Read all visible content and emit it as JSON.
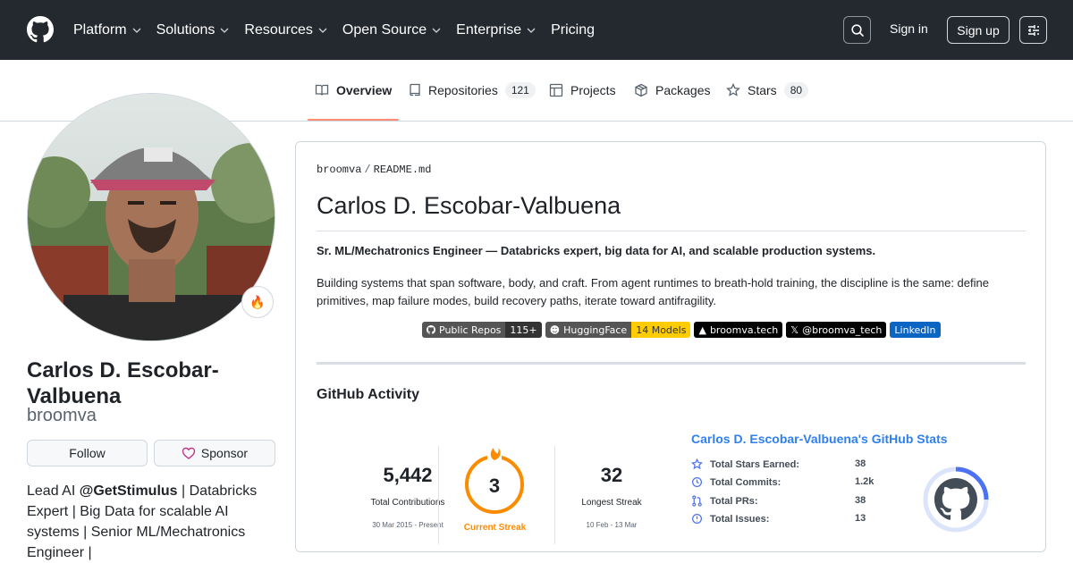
{
  "header": {
    "nav": [
      {
        "label": "Platform",
        "dropdown": true
      },
      {
        "label": "Solutions",
        "dropdown": true
      },
      {
        "label": "Resources",
        "dropdown": true
      },
      {
        "label": "Open Source",
        "dropdown": true
      },
      {
        "label": "Enterprise",
        "dropdown": true
      },
      {
        "label": "Pricing",
        "dropdown": false
      }
    ],
    "signin": "Sign in",
    "signup": "Sign up"
  },
  "tabs": [
    {
      "label": "Overview",
      "icon": "book-icon"
    },
    {
      "label": "Repositories",
      "count": "121",
      "icon": "repo-icon"
    },
    {
      "label": "Projects",
      "icon": "table-icon"
    },
    {
      "label": "Packages",
      "icon": "package-icon"
    },
    {
      "label": "Stars",
      "count": "80",
      "icon": "star-icon"
    }
  ],
  "profile": {
    "name": "Carlos D. Escobar-Valbuena",
    "username": "broomva",
    "status_emoji": "🔥",
    "follow": "Follow",
    "sponsor": "Sponsor",
    "bio_prefix": "Lead AI ",
    "bio_org": "@GetStimulus",
    "bio_rest": " | Databricks Expert | Big Data for scalable AI systems | Senior ML/Mechatronics Engineer |"
  },
  "readme": {
    "path_owner": "broomva",
    "path_sep": "/",
    "path_file": "README.md",
    "title": "Carlos D. Escobar-Valbuena",
    "lead": "Sr. ML/Mechatronics Engineer — Databricks expert, big data for AI, and scalable production systems.",
    "desc": "Building systems that span software, body, and craft. From agent runtimes to breath-hold training, the discipline is the same: define primitives, map failure modes, build recovery paths, iterate toward antifragility.",
    "badges": [
      {
        "left": "Public Repos",
        "right": "115+",
        "left_color": "#555555",
        "right_color": "#333333"
      },
      {
        "left": "HuggingFace",
        "right": "14 Models",
        "left_color": "#555555",
        "right_color": "#ffcc00"
      },
      {
        "left": "broomva.tech",
        "right": "",
        "left_color": "#000000",
        "right_color": "#000000"
      },
      {
        "left": "@broomva_tech",
        "right": "",
        "left_color": "#000000",
        "right_color": "#000000"
      },
      {
        "left": "LinkedIn",
        "right": "",
        "left_color": "#0a66c2",
        "right_color": "#0a66c2"
      }
    ],
    "activity_heading": "GitHub Activity"
  },
  "streak": {
    "total": "5,442",
    "total_label": "Total Contributions",
    "total_range": "30 Mar 2015 - Present",
    "current": "3",
    "current_label": "Current Streak",
    "longest": "32",
    "longest_label": "Longest Streak",
    "longest_range": "10 Feb - 13 Mar",
    "accent": "#fb8c00"
  },
  "stats": {
    "title": "Carlos D. Escobar-Valbuena's GitHub Stats",
    "rows": [
      {
        "label": "Total Stars Earned:",
        "value": "38",
        "icon": "star-icon"
      },
      {
        "label": "Total Commits:",
        "value": "1.2k",
        "icon": "commit-icon"
      },
      {
        "label": "Total PRs:",
        "value": "38",
        "icon": "pr-icon"
      },
      {
        "label": "Total Issues:",
        "value": "13",
        "icon": "issue-icon"
      }
    ],
    "title_color": "#2f80ed",
    "icon_color": "#4c71f2"
  }
}
